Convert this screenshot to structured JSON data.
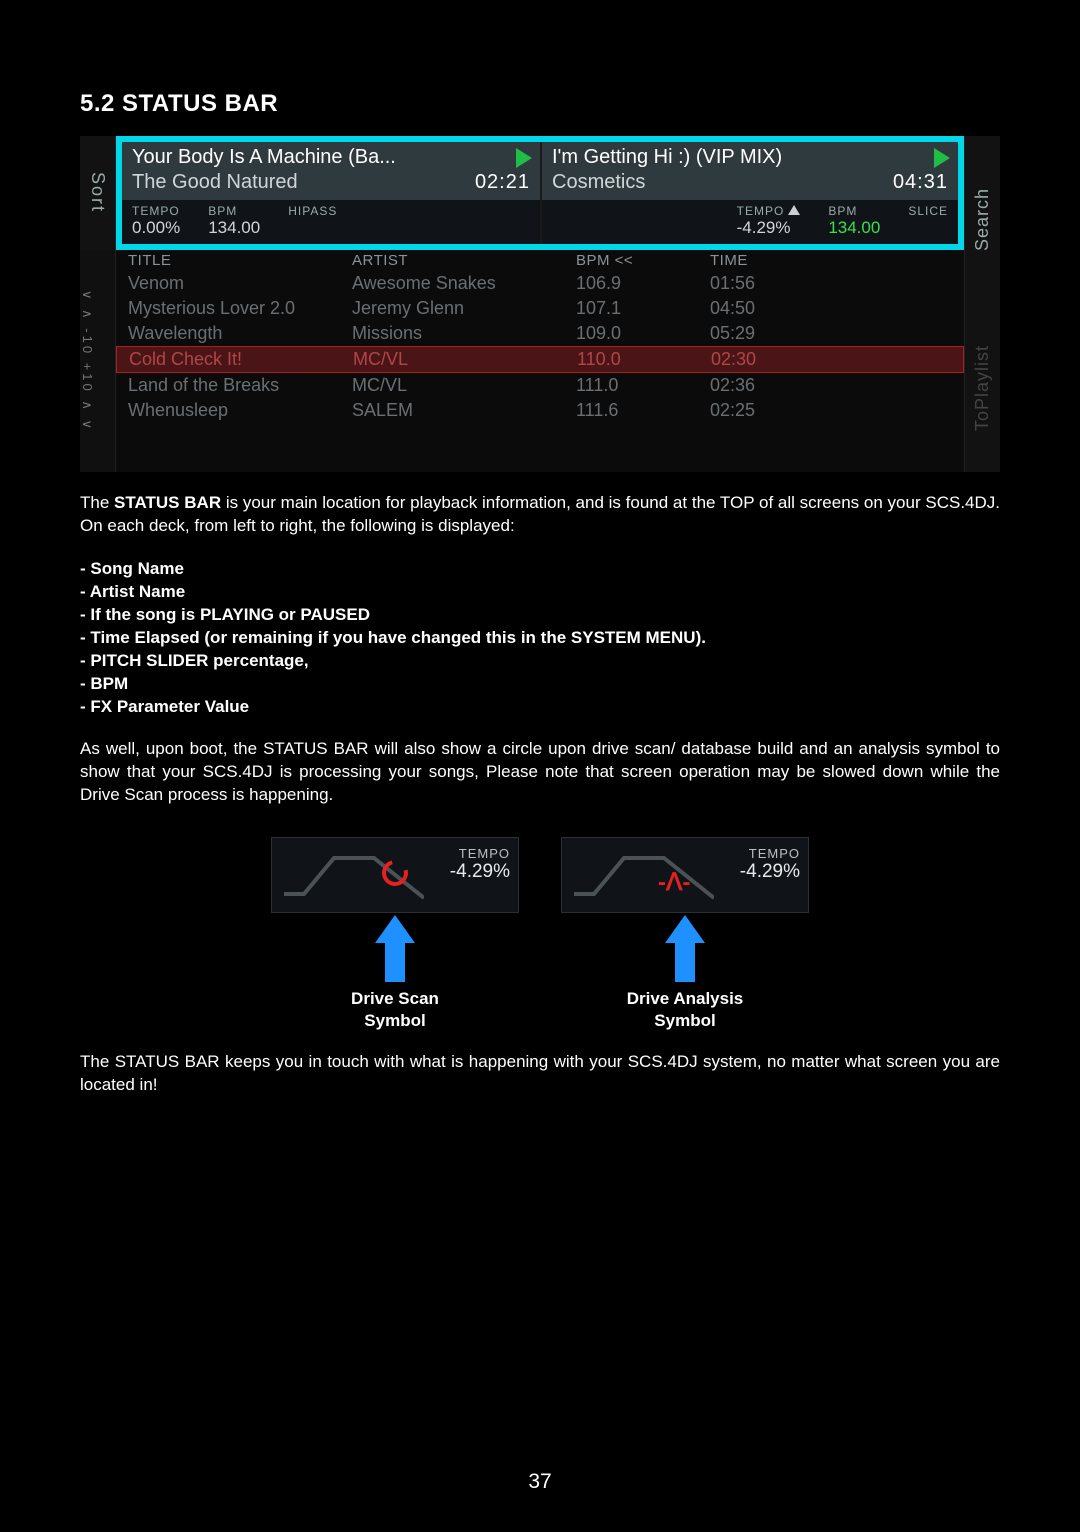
{
  "heading": "5.2 STATUS BAR",
  "page_number": "37",
  "sort_label": "Sort",
  "search_label": "Search",
  "toplaylist_label": "ToPlaylist",
  "nav_text": "∨ ∧ -10  +10 ∧ ∨",
  "deck_a": {
    "song": "Your Body Is A Machine (Ba...",
    "artist": "The Good Natured",
    "time": "02:21",
    "tempo_label": "TEMPO",
    "tempo_value": "0.00%",
    "bpm_label": "BPM",
    "bpm_value": "134.00",
    "fx_label": "HIPASS"
  },
  "deck_b": {
    "song": "I'm Getting Hi :) (VIP MIX)",
    "artist": "Cosmetics",
    "time": "04:31",
    "tempo_label": "TEMPO",
    "tempo_value": "-4.29%",
    "bpm_label": "BPM",
    "bpm_value": "134.00",
    "fx_label": "SLICE"
  },
  "tl_headers": {
    "title": "TITLE",
    "artist": "ARTIST",
    "bpm": "BPM <<",
    "time": "TIME"
  },
  "tracks": [
    {
      "title": "Venom",
      "artist": "Awesome Snakes",
      "bpm": "106.9",
      "time": "01:56"
    },
    {
      "title": "Mysterious Lover 2.0",
      "artist": "Jeremy Glenn",
      "bpm": "107.1",
      "time": "04:50"
    },
    {
      "title": "Wavelength",
      "artist": "Missions",
      "bpm": "109.0",
      "time": "05:29"
    },
    {
      "title": "Cold Check It!",
      "artist": "MC/VL",
      "bpm": "110.0",
      "time": "02:30"
    },
    {
      "title": "Land of the Breaks",
      "artist": "MC/VL",
      "bpm": "111.0",
      "time": "02:36"
    },
    {
      "title": "Whenusleep",
      "artist": "SALEM",
      "bpm": "111.6",
      "time": "02:25"
    }
  ],
  "selected_index": 3,
  "para1a": "The ",
  "para1b": "STATUS BAR",
  "para1c": " is your main location for playback information, and is found at the TOP of all screens on your SCS.4DJ. On each deck, from left to right, the following is displayed:",
  "bullets": [
    "- Song Name",
    "- Artist Name",
    "- If the song is PLAYING or PAUSED",
    "- Time Elapsed (or remaining if you have changed this in the SYSTEM MENU).",
    "- PITCH SLIDER percentage,",
    "- BPM",
    "- FX Parameter Value"
  ],
  "para2": "As well, upon boot, the STATUS BAR will also show a circle upon drive scan/ database build and an analysis symbol to show that your SCS.4DJ is processing your songs, Please note that screen operation may be slowed down while the Drive Scan process is happening.",
  "mini_tempo_label": "TEMPO",
  "mini_tempo_value": "-4.29%",
  "mini1_label_l1": "Drive Scan",
  "mini1_label_l2": "Symbol",
  "mini2_label_l1": "Drive Analysis",
  "mini2_label_l2": "Symbol",
  "para3": "The STATUS BAR keeps you in touch with what is happening with your SCS.4DJ system, no matter what screen you are located in!"
}
